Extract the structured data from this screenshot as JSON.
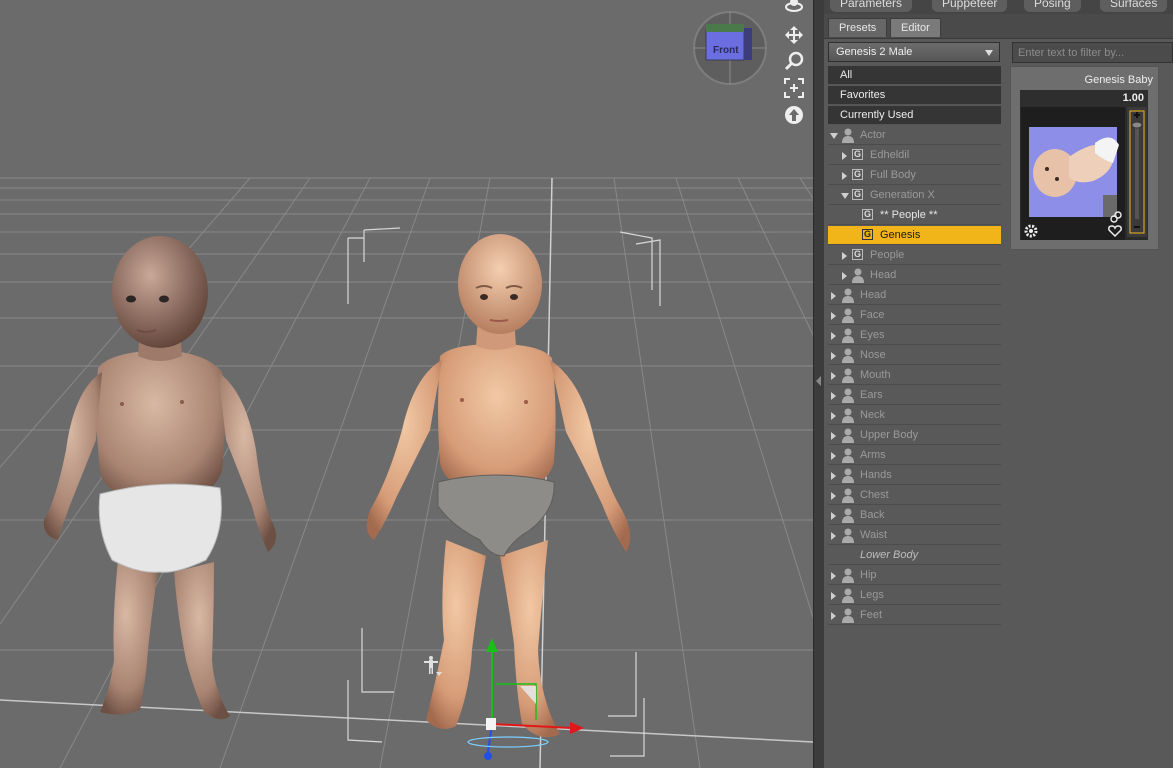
{
  "panel": {
    "top_tabs": [
      "Parameters",
      "Puppeteer",
      "Posing",
      "Surfaces"
    ],
    "sub_tabs": [
      {
        "label": "Presets",
        "active": false
      },
      {
        "label": "Editor",
        "active": true
      }
    ],
    "figure_select": "Genesis 2 Male",
    "filter_placeholder": "Enter text to filter by...",
    "tree": [
      {
        "label": "All"
      },
      {
        "label": "Favorites"
      },
      {
        "label": "Currently Used"
      },
      {
        "label": "Actor"
      },
      {
        "label": "Edheldil"
      },
      {
        "label": "Full Body"
      },
      {
        "label": "Generation X"
      },
      {
        "label": "** People **"
      },
      {
        "label": "Genesis"
      },
      {
        "label": "People"
      },
      {
        "label": "Head"
      },
      {
        "label": "Head"
      },
      {
        "label": "Face"
      },
      {
        "label": "Eyes"
      },
      {
        "label": "Nose"
      },
      {
        "label": "Mouth"
      },
      {
        "label": "Ears"
      },
      {
        "label": "Neck"
      },
      {
        "label": "Upper Body"
      },
      {
        "label": "Arms"
      },
      {
        "label": "Hands"
      },
      {
        "label": "Chest"
      },
      {
        "label": "Back"
      },
      {
        "label": "Waist"
      },
      {
        "label": "Lower Body"
      },
      {
        "label": "Hip"
      },
      {
        "label": "Legs"
      },
      {
        "label": "Feet"
      }
    ],
    "preset_card": {
      "title": "Genesis Baby",
      "value": "1.00",
      "slider_fraction": 1.0
    }
  },
  "viewport": {
    "cube_label": "Front",
    "tools": [
      "orbit-icon",
      "pan-icon",
      "zoom-icon",
      "frame-icon",
      "home-icon"
    ]
  },
  "colors": {
    "selection": "#f2b519",
    "viewport_bg": "#6b6b6b",
    "panel_bg": "#595959"
  }
}
